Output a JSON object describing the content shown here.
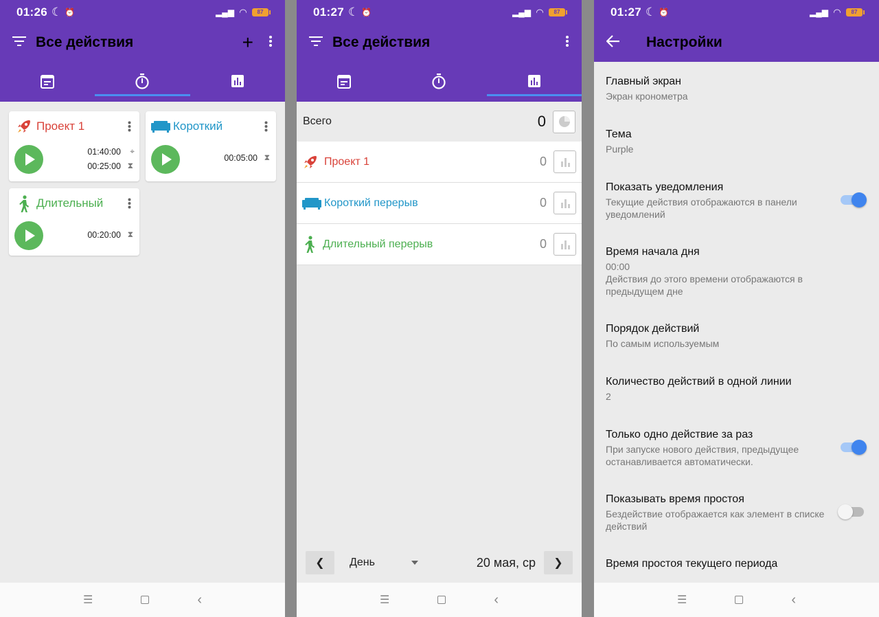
{
  "colors": {
    "primary": "#673ab7",
    "accent": "#4a8ff0",
    "play": "#5cb85c",
    "project_red": "#d9433a",
    "short_blue": "#2196c8",
    "long_green": "#4caf50"
  },
  "screen1": {
    "status": {
      "time": "01:26",
      "battery": "87"
    },
    "title": "Все действия",
    "tabs": [
      "calendar-icon",
      "timer-icon",
      "stats-icon"
    ],
    "cards": [
      {
        "name": "Проект 1",
        "icon": "rocket-icon",
        "times": [
          {
            "value": "01:40:00",
            "icon": "target-icon"
          },
          {
            "value": "00:25:00",
            "icon": "hourglass-icon"
          }
        ]
      },
      {
        "name": "Короткий",
        "icon": "sofa-icon",
        "times": [
          {
            "value": "00:05:00",
            "icon": "hourglass-icon"
          }
        ]
      },
      {
        "name": "Длительный",
        "icon": "walker-icon",
        "times": [
          {
            "value": "00:20:00",
            "icon": "hourglass-icon"
          }
        ]
      }
    ]
  },
  "screen2": {
    "status": {
      "time": "01:27",
      "battery": "87"
    },
    "title": "Все действия",
    "total": {
      "label": "Всего",
      "value": "0"
    },
    "rows": [
      {
        "name": "Проект 1",
        "value": "0"
      },
      {
        "name": "Короткий перерыв",
        "value": "0"
      },
      {
        "name": "Длительный перерыв",
        "value": "0"
      }
    ],
    "period": "День",
    "date": "20 мая, ср"
  },
  "screen3": {
    "status": {
      "time": "01:27",
      "battery": "87"
    },
    "title": "Настройки",
    "settings": [
      {
        "title": "Главный экран",
        "subtitle": "Экран кронометра"
      },
      {
        "title": "Тема",
        "subtitle": "Purple"
      },
      {
        "title": "Показать уведомления",
        "subtitle": "Текущие действия отображаются в панели уведомлений",
        "toggle": true
      },
      {
        "title": "Время начала дня",
        "subtitle": "00:00",
        "subtitle2": "Действия до этого времени отображаются в предыдущем дне"
      },
      {
        "title": "Порядок действий",
        "subtitle": "По самым используемым"
      },
      {
        "title": "Количество действий в одной линии",
        "subtitle": "2"
      },
      {
        "title": "Только одно действие за раз",
        "subtitle": "При запуске нового действия, предыдущее останавливается автоматически.",
        "toggle": true
      },
      {
        "title": "Показывать время простоя",
        "subtitle": "Бездействие отображается как элемент в списке действий",
        "toggle": false
      },
      {
        "title": "Время простоя текущего периода",
        "subtitle": ""
      }
    ]
  }
}
